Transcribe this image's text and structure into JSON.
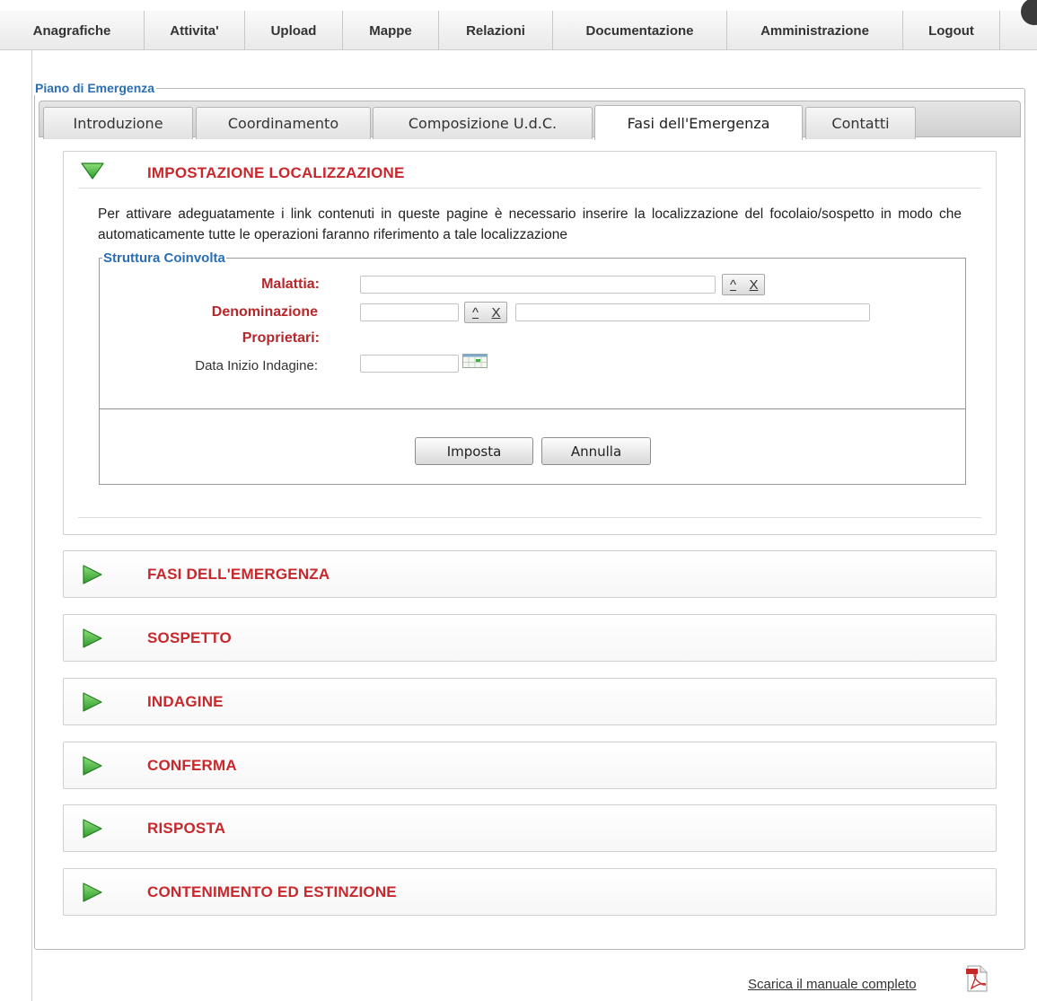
{
  "nav": {
    "items": [
      "Anagrafiche",
      "Attivita'",
      "Upload",
      "Mappe",
      "Relazioni",
      "Documentazione",
      "Amministrazione",
      "Logout"
    ]
  },
  "page": {
    "legend": "Piano di Emergenza"
  },
  "tabs": {
    "items": [
      "Introduzione",
      "Coordinamento",
      "Composizione U.d.C.",
      "Fasi dell'Emergenza",
      "Contatti"
    ],
    "active": "Fasi dell'Emergenza"
  },
  "localizzazione": {
    "title": "IMPOSTAZIONE LOCALIZZAZIONE",
    "intro": "Per attivare adeguatamente i link contenuti in queste pagine è necessario inserire la localizzazione del focolaio/sospetto in modo che automaticamente tutte le operazioni faranno riferimento a tale localizzazione",
    "fieldset_legend": "Struttura Coinvolta",
    "fields": {
      "malattia_label": "Malattia:",
      "denominazione_label": "Denominazione",
      "proprietari_label": "Proprietari:",
      "data_label": "Data Inizio Indagine:"
    },
    "lookup_open": "^",
    "lookup_clear": "X",
    "buttons": {
      "imposta": "Imposta",
      "annulla": "Annulla"
    }
  },
  "sections": [
    "FASI DELL'EMERGENZA",
    "SOSPETTO",
    "INDAGINE",
    "CONFERMA",
    "RISPOSTA",
    "CONTENIMENTO ED ESTINZIONE"
  ],
  "footer": {
    "manual_link": "Scarica il manuale completo"
  },
  "colors": {
    "section_title": "#c8282c",
    "legend": "#2a6fb5",
    "icon_green": "#3fb43a"
  }
}
